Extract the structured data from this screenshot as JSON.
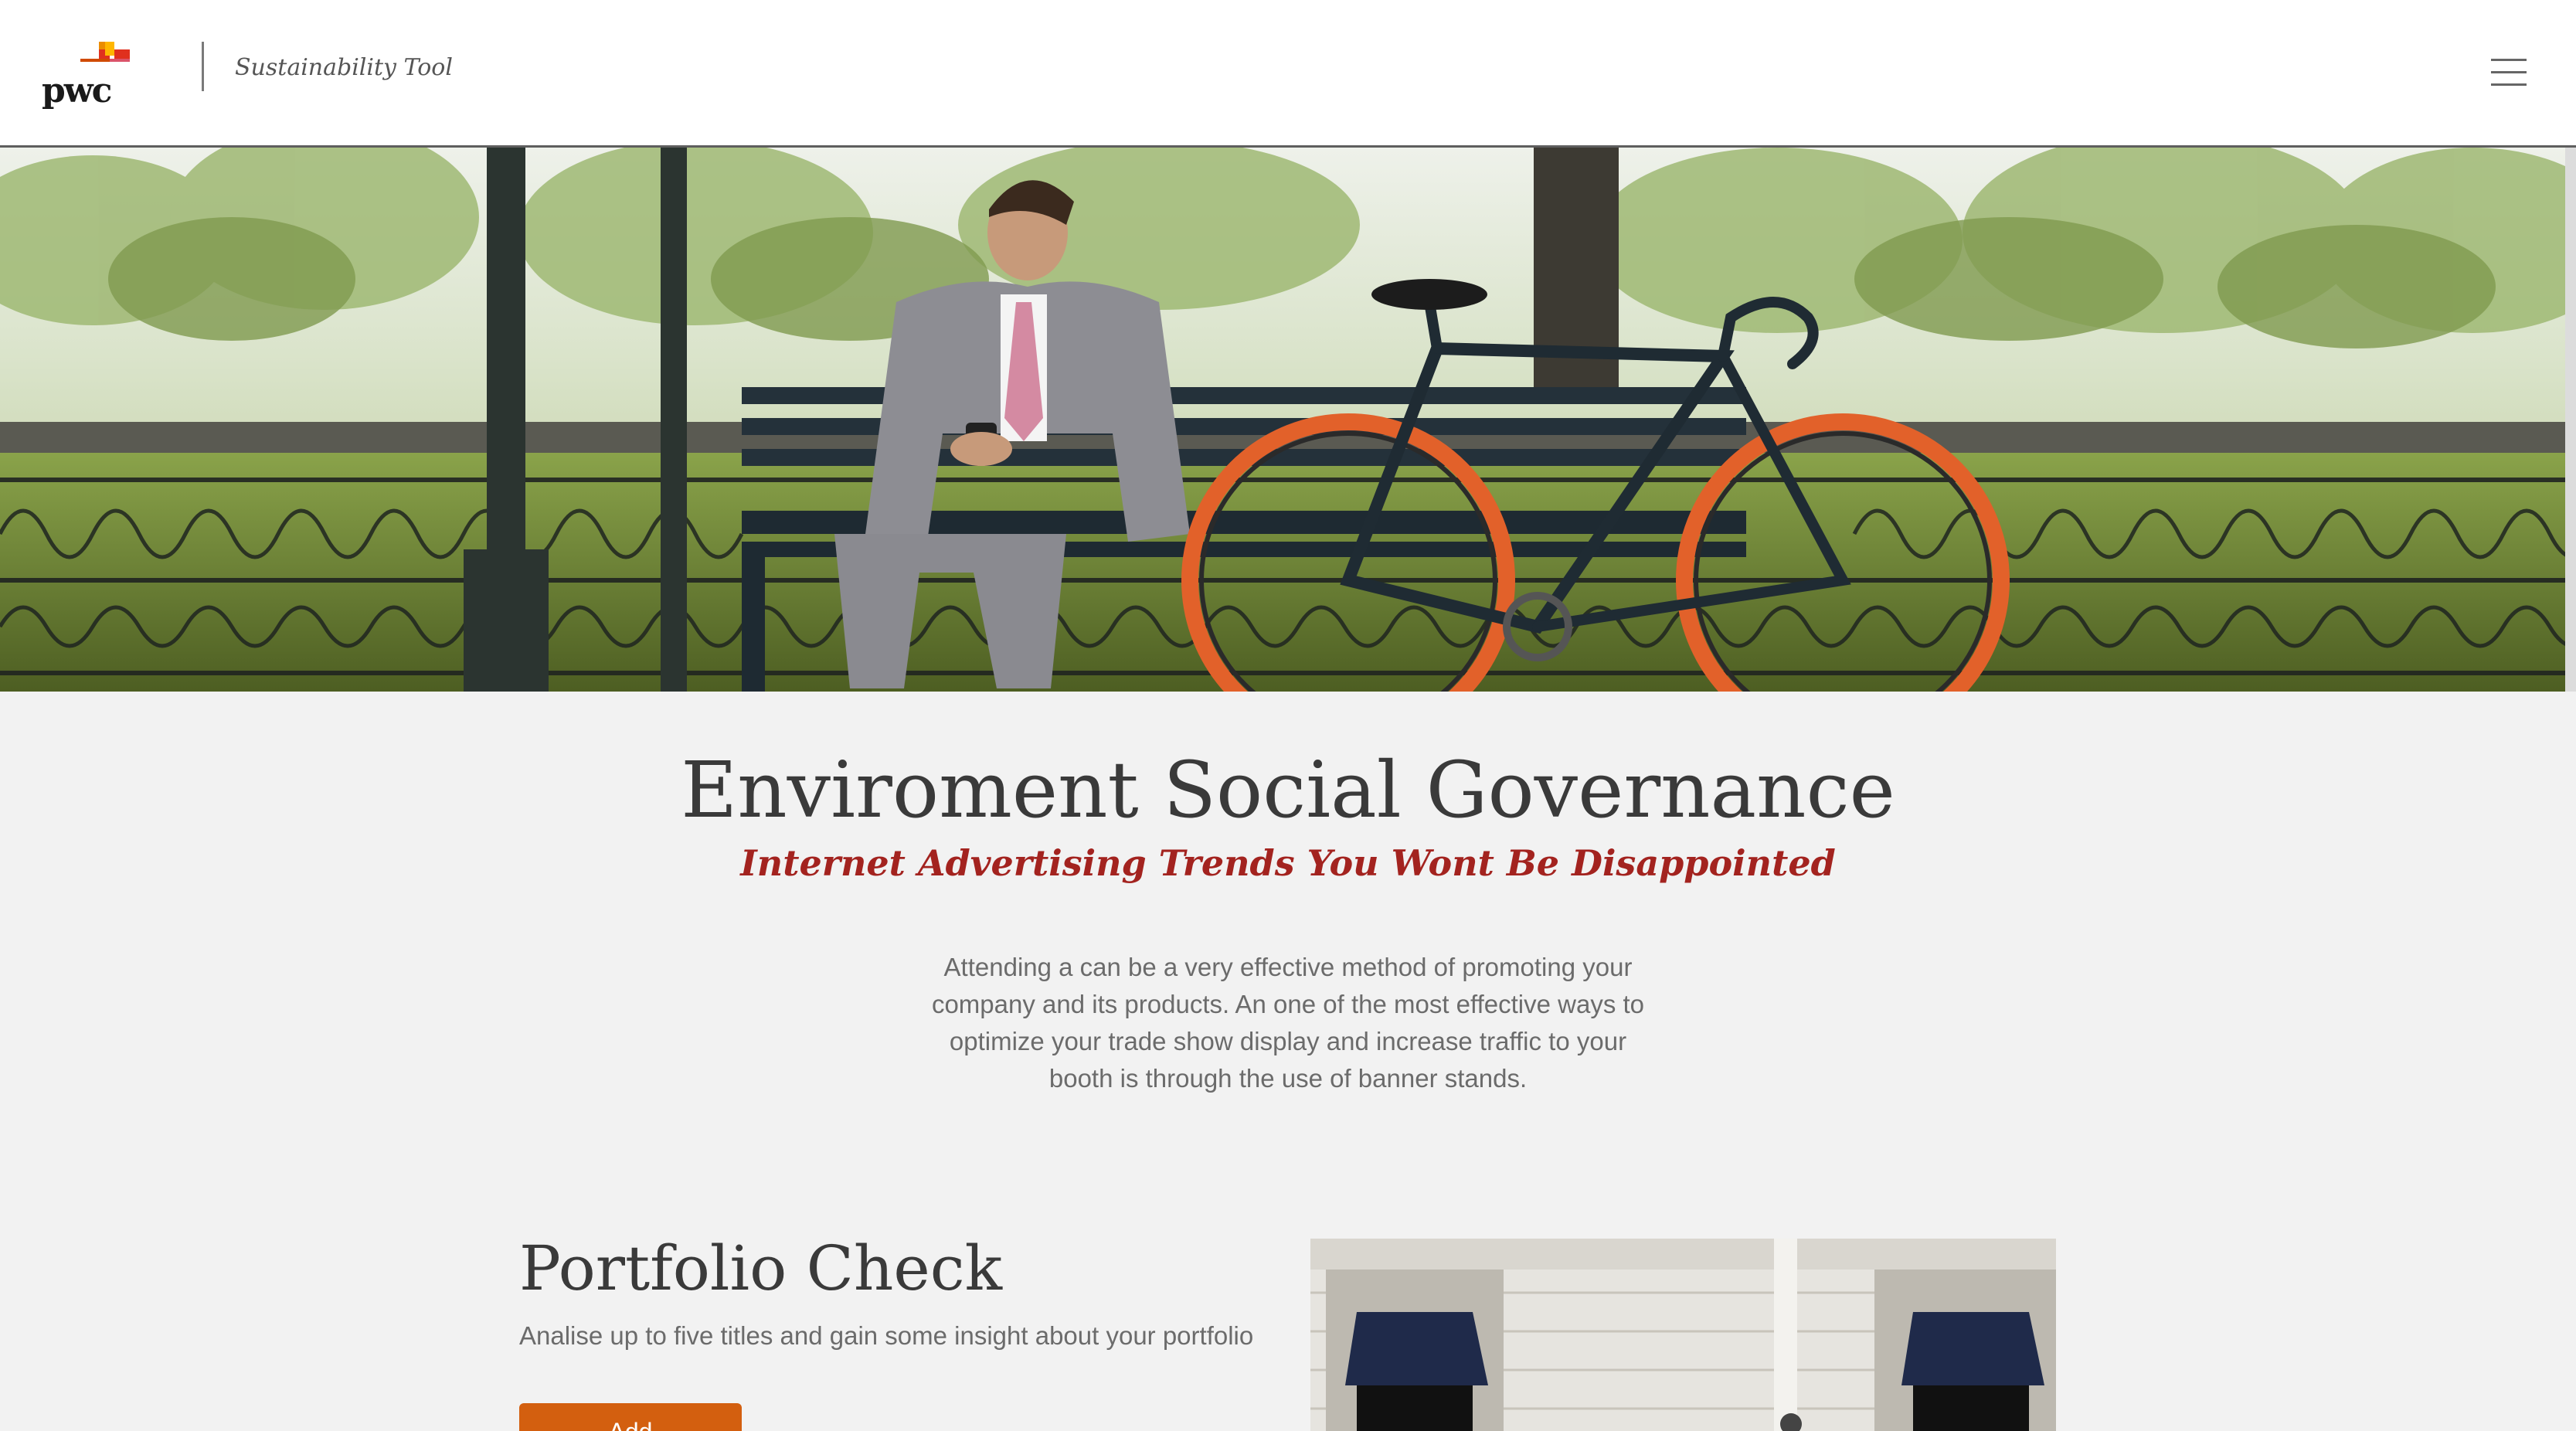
{
  "header": {
    "logo_text": "pwc",
    "app_title": "Sustainability Tool",
    "menu_icon": "hamburger-menu-icon"
  },
  "hero": {
    "image": "man-on-bench-with-bicycle-photo"
  },
  "intro": {
    "title": "Enviroment Social Governance",
    "subtitle": "Internet Advertising Trends You Wont Be Disappointed",
    "body": "Attending a can be a very effective method of promoting your company and its products. An one of the most effective ways to optimize your trade show display and increase traffic to your booth is through the use of banner stands."
  },
  "portfolio": {
    "title": "Portfolio Check",
    "description": "Analise up to five titles and gain some insight about your portfolio",
    "button_label": "Add",
    "image": "building-facade-photo"
  },
  "colors": {
    "accent_red": "#a3231f",
    "button_orange": "#d35f0f",
    "page_bg": "#f2f2f2"
  }
}
